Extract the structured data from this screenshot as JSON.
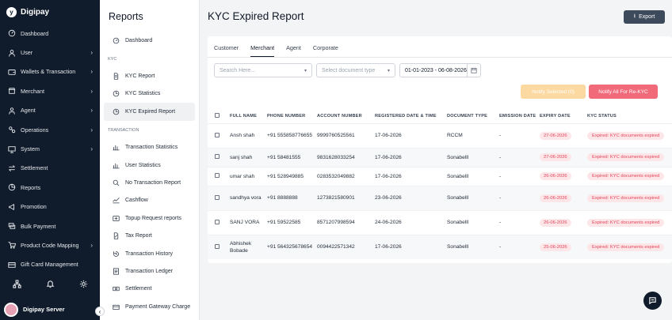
{
  "brand": {
    "name": "Digipay",
    "logo_letter": "y"
  },
  "sidebar": {
    "items": [
      {
        "label": "Dashboard",
        "icon": "speedometer-icon",
        "chevron": false
      },
      {
        "label": "User",
        "icon": "user-icon",
        "chevron": true
      },
      {
        "label": "Wallets & Transaction",
        "icon": "wallet-icon",
        "chevron": true
      },
      {
        "label": "Merchant",
        "icon": "store-icon",
        "chevron": true
      },
      {
        "label": "Agent",
        "icon": "agent-icon",
        "chevron": true
      },
      {
        "label": "Operations",
        "icon": "operations-icon",
        "chevron": true
      },
      {
        "label": "System",
        "icon": "monitor-icon",
        "chevron": true
      },
      {
        "label": "Settlement",
        "icon": "transfer-icon",
        "chevron": false
      },
      {
        "label": "Reports",
        "icon": "report-icon",
        "chevron": false
      },
      {
        "label": "Promotion",
        "icon": "megaphone-icon",
        "chevron": false
      },
      {
        "label": "Bulk Payment",
        "icon": "bulk-icon",
        "chevron": false
      },
      {
        "label": "Product Code Mapping",
        "icon": "cart-icon",
        "chevron": true
      },
      {
        "label": "Gift Card Management",
        "icon": "giftcard-icon",
        "chevron": false
      }
    ],
    "chevron_glyph": "›"
  },
  "user": {
    "name": "Digipay Server"
  },
  "collapse_glyph": "‹",
  "subnav": {
    "title": "Reports",
    "top_items": [
      {
        "label": "Dashboard",
        "icon": "dashboard-icon"
      }
    ],
    "kyc_section": "KYC",
    "kyc_items": [
      {
        "label": "KYC Report",
        "icon": "document-icon"
      },
      {
        "label": "KYC Statistics",
        "icon": "clock-icon"
      },
      {
        "label": "KYC Expired Report",
        "icon": "clock-icon",
        "active": true
      }
    ],
    "transaction_section": "TRANSACTION",
    "transaction_items": [
      {
        "label": "Transaction Statistics",
        "icon": "barchart-icon"
      },
      {
        "label": "User Statistics",
        "icon": "barchart-icon"
      },
      {
        "label": "No Transaction Report",
        "icon": "search-x-icon"
      },
      {
        "label": "Cashflow",
        "icon": "cashflow-icon"
      },
      {
        "label": "Topup Request reports",
        "icon": "topup-icon"
      },
      {
        "label": "Tax Report",
        "icon": "tax-icon"
      },
      {
        "label": "Transaction History",
        "icon": "history-icon"
      },
      {
        "label": "Transaction Ledger",
        "icon": "ledger-icon"
      },
      {
        "label": "Settlement",
        "icon": "settlement-icon"
      },
      {
        "label": "Payment Gateway Charge",
        "icon": "gateway-icon"
      }
    ]
  },
  "page": {
    "title": "KYC Expired Report",
    "export_label": "Export",
    "export_icon": "⭳"
  },
  "tabs": [
    {
      "label": "Customer"
    },
    {
      "label": "Merchant",
      "active": true
    },
    {
      "label": "Agent"
    },
    {
      "label": "Corporate"
    }
  ],
  "filters": {
    "search_placeholder": "Search Here...",
    "doc_placeholder": "Select document type",
    "date_range": "01-01-2023 - 06-08-2026",
    "caret": "▾"
  },
  "actions": {
    "notify_selected": "Notify Selected (0)",
    "notify_all": "Notify All For Re-KYC"
  },
  "table": {
    "headers": [
      "FULL NAME",
      "PHONE NUMBER",
      "ACCOUNT NUMBER",
      "REGISTERED DATE & TIME",
      "DOCUMENT TYPE",
      "EMISSION DATE",
      "EXPIRY DATE",
      "KYC STATUS"
    ],
    "rows": [
      {
        "name": "Ansh shah",
        "phone": "+91 555858776655",
        "account": "9999760525561",
        "registered": "17-06-2026",
        "doc": "RCCM",
        "emission": "-",
        "expiry": "27-06-2026",
        "status": "Expired: KYC documents expired"
      },
      {
        "name": "sanj shah",
        "phone": "+91 58481555",
        "account": "9831628033254",
        "registered": "17-06-2026",
        "doc": "Sonabelll",
        "emission": "-",
        "expiry": "27-06-2026",
        "status": "Expired: KYC documents expired"
      },
      {
        "name": "umar shah",
        "phone": "+91 528949885",
        "account": "0283532049882",
        "registered": "17-06-2026",
        "doc": "Sonabelll",
        "emission": "-",
        "expiry": "26-06-2026",
        "status": "Expired: KYC documents expired"
      },
      {
        "name": "sandhya vora",
        "phone": "+91 8888888",
        "account": "1273821580901",
        "registered": "23-06-2026",
        "doc": "Sonabelll",
        "emission": "-",
        "expiry": "26-06-2026",
        "status": "Expired: KYC documents expired"
      },
      {
        "name": "SANJ VORA",
        "phone": "+91 59522585",
        "account": "8571207998594",
        "registered": "24-06-2026",
        "doc": "Sonabelll",
        "emission": "-",
        "expiry": "26-06-2026",
        "status": "Expired: KYC documents expired"
      },
      {
        "name": "Abhishek Bobade",
        "phone": "+91 564325678654",
        "account": "0094422571342",
        "registered": "17-06-2026",
        "doc": "Sonabelll",
        "emission": "-",
        "expiry": "25-06-2026",
        "status": "Expired: KYC documents expired"
      }
    ]
  },
  "colors": {
    "sidebar": "#101c2c",
    "notify_all": "#f16a7a",
    "notify_selected": "#fcd9a0",
    "status_text": "#e2455b",
    "status_bg": "#fde6e8"
  }
}
